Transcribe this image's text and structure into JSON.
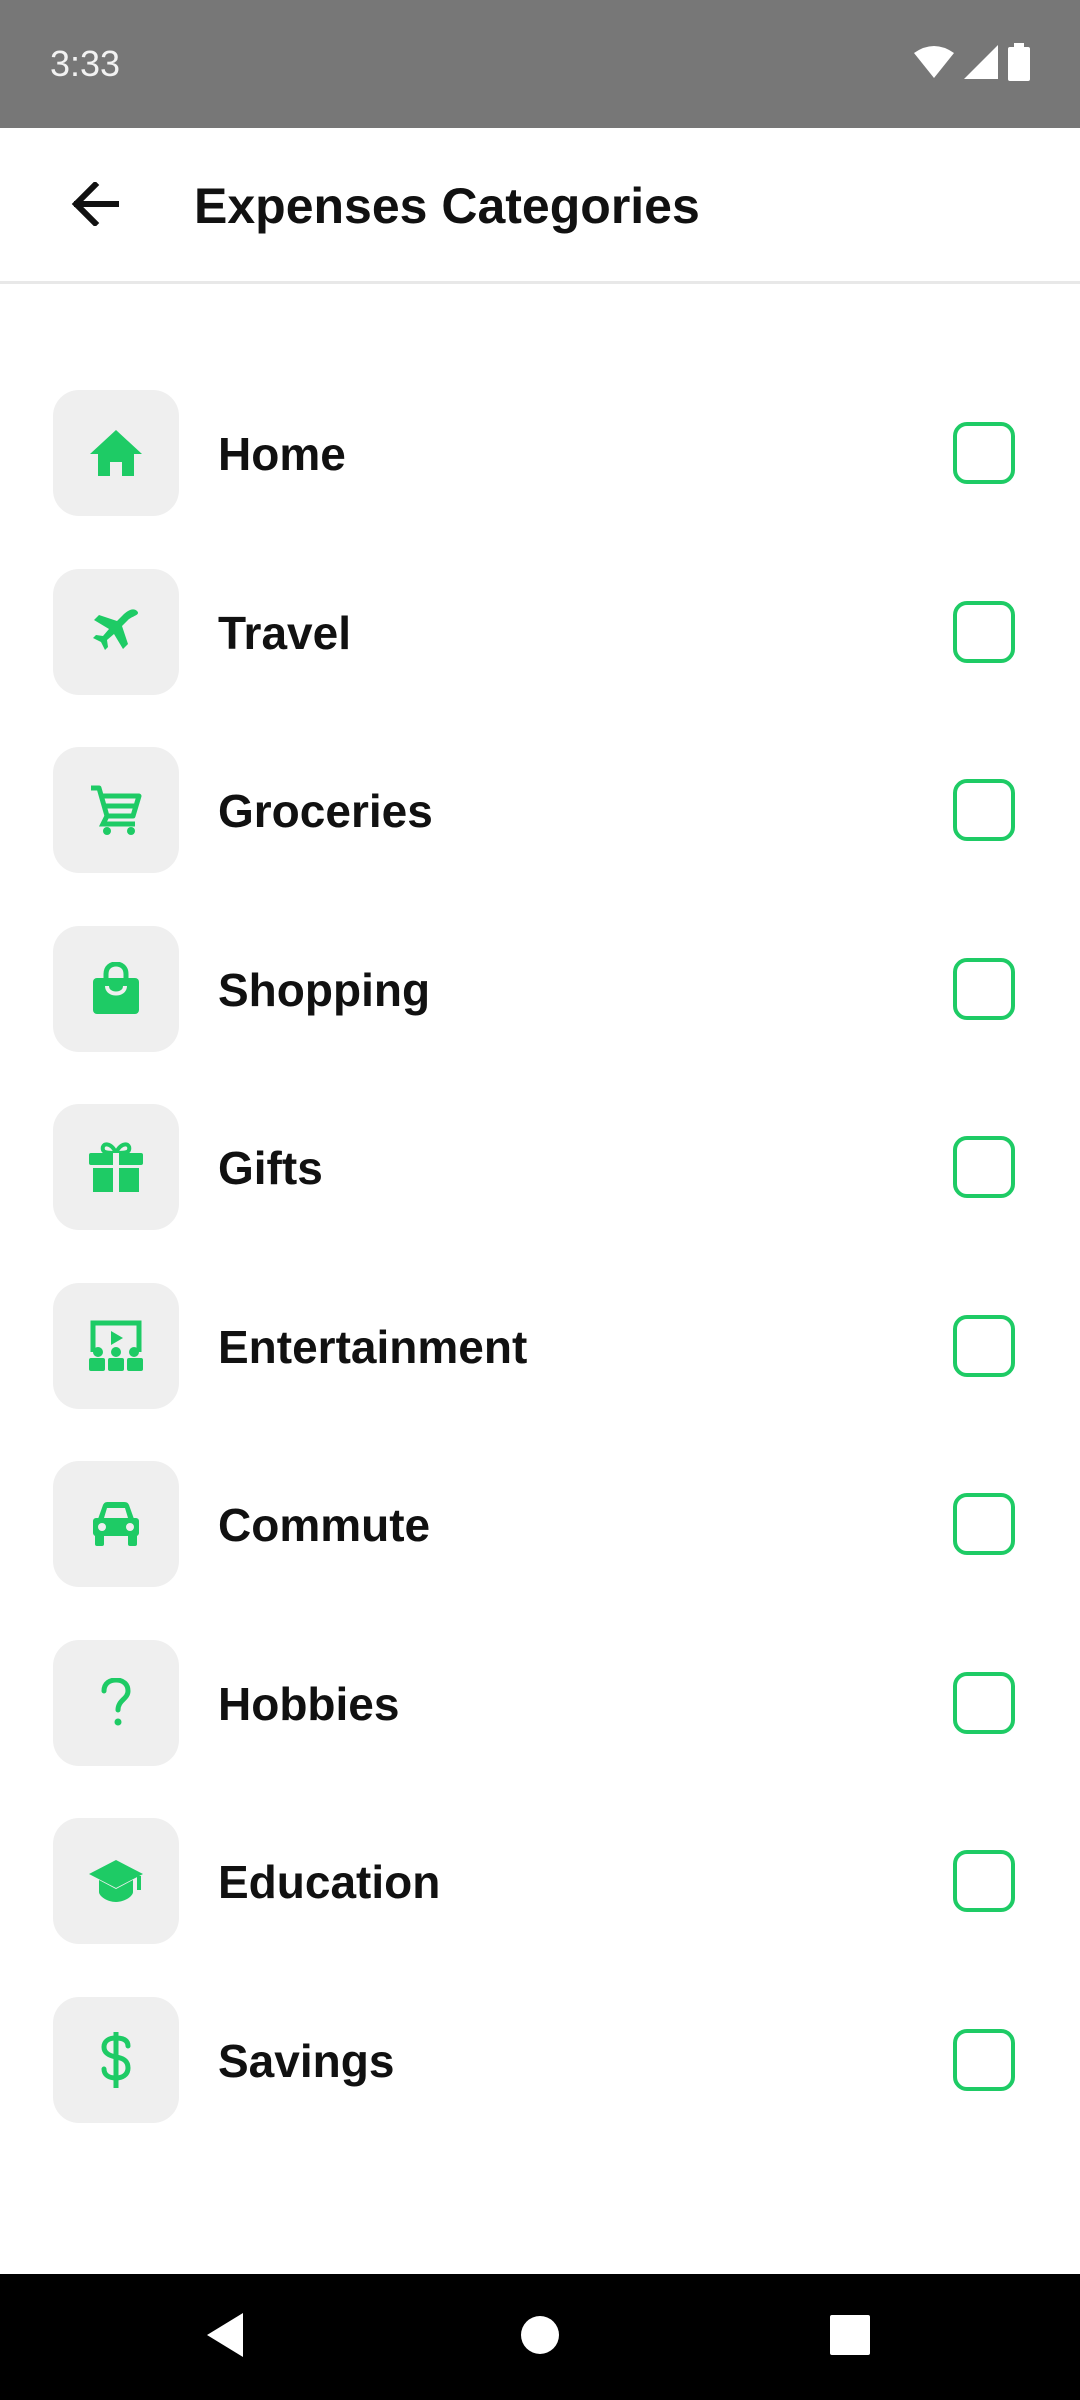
{
  "status_bar": {
    "time": "3:33",
    "icons": [
      "wifi-icon",
      "signal-icon",
      "battery-icon"
    ]
  },
  "header": {
    "back_icon": "arrow-left-icon",
    "title": "Expenses Categories"
  },
  "colors": {
    "accent": "#1ecb65",
    "tile_bg": "#efefef",
    "status_bar_bg": "#777777",
    "nav_bar_bg": "#000000"
  },
  "categories": [
    {
      "label": "Home",
      "icon": "home-icon",
      "checked": false
    },
    {
      "label": "Travel",
      "icon": "airplane-icon",
      "checked": false
    },
    {
      "label": "Groceries",
      "icon": "cart-icon",
      "checked": false
    },
    {
      "label": "Shopping",
      "icon": "shopping-bag-icon",
      "checked": false
    },
    {
      "label": "Gifts",
      "icon": "gift-icon",
      "checked": false
    },
    {
      "label": "Entertainment",
      "icon": "theater-icon",
      "checked": false
    },
    {
      "label": "Commute",
      "icon": "car-icon",
      "checked": false
    },
    {
      "label": "Hobbies",
      "icon": "question-mark-icon",
      "checked": false
    },
    {
      "label": "Education",
      "icon": "graduation-cap-icon",
      "checked": false
    },
    {
      "label": "Savings",
      "icon": "dollar-icon",
      "checked": false
    }
  ],
  "nav_bar": {
    "icons": [
      "nav-back-icon",
      "nav-home-icon",
      "nav-recents-icon"
    ]
  }
}
